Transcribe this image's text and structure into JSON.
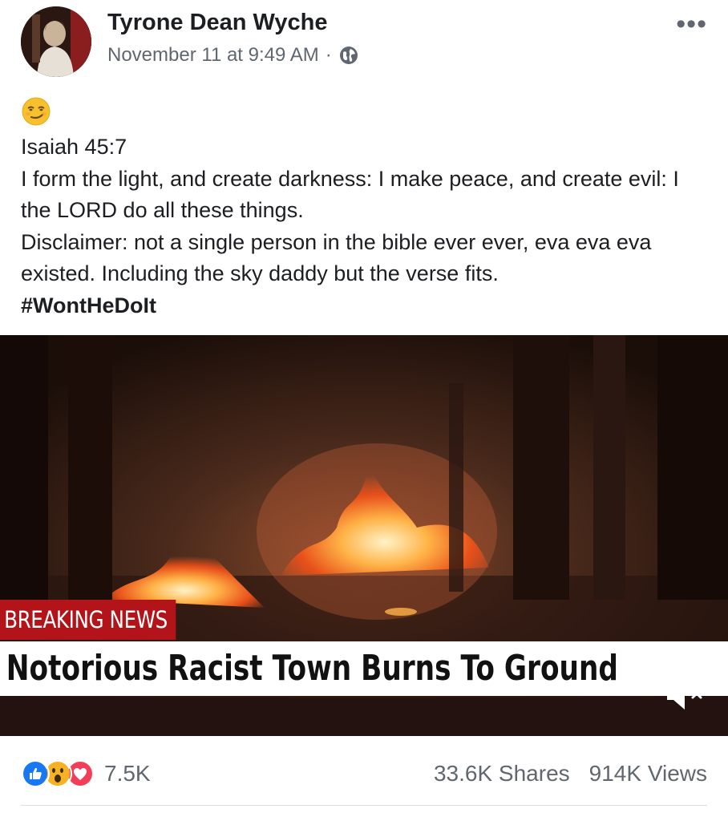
{
  "post": {
    "author": "Tyrone Dean Wyche",
    "timestamp": "November 11 at 9:49 AM",
    "separator": "·",
    "privacy_icon": "globe-icon",
    "more_icon": "more-options-icon",
    "more_label": "•••",
    "emoji": "smirking-face-emoji",
    "lines": [
      "Isaiah 45:7",
      "I form the light, and create darkness: I make peace, and create evil: I the LORD do all these things.",
      "Disclaimer: not a single person in the bible ever ever, eva eva eva existed. Including the sky daddy but the verse fits."
    ],
    "hashtag": "#WontHeDoIt"
  },
  "video": {
    "breaking_label": "BREAKING NEWS",
    "headline": "Notorious Racist Town Burns To Ground",
    "mute_icon": "speaker-muted-icon",
    "accent_color": "#b3141a"
  },
  "footer": {
    "reaction_icons": [
      "like-icon",
      "wow-icon",
      "love-icon"
    ],
    "reaction_count": "7.5K",
    "shares": "33.6K Shares",
    "views": "914K Views"
  },
  "colors": {
    "text": "#1c1e21",
    "secondary": "#606770",
    "like_blue": "#1877f2",
    "love_red": "#f33e58",
    "wow_yellow": "#f7b125"
  }
}
